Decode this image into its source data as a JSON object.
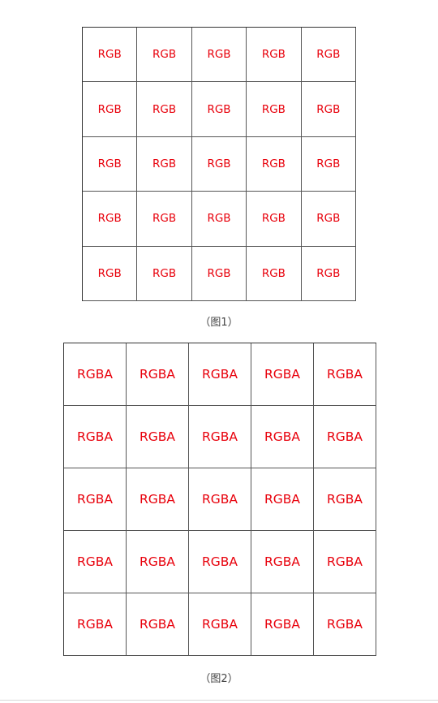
{
  "figure1": {
    "caption": "（图1）",
    "rows": [
      [
        "RGB",
        "RGB",
        "RGB",
        "RGB",
        "RGB"
      ],
      [
        "RGB",
        "RGB",
        "RGB",
        "RGB",
        "RGB"
      ],
      [
        "RGB",
        "RGB",
        "RGB",
        "RGB",
        "RGB"
      ],
      [
        "RGB",
        "RGB",
        "RGB",
        "RGB",
        "RGB"
      ],
      [
        "RGB",
        "RGB",
        "RGB",
        "RGB",
        "RGB"
      ]
    ]
  },
  "figure2": {
    "caption": "（图2）",
    "rows": [
      [
        "RGBA",
        "RGBA",
        "RGBA",
        "RGBA",
        "RGBA"
      ],
      [
        "RGBA",
        "RGBA",
        "RGBA",
        "RGBA",
        "RGBA"
      ],
      [
        "RGBA",
        "RGBA",
        "RGBA",
        "RGBA",
        "RGBA"
      ],
      [
        "RGBA",
        "RGBA",
        "RGBA",
        "RGBA",
        "RGBA"
      ],
      [
        "RGBA",
        "RGBA",
        "RGBA",
        "RGBA",
        "RGBA"
      ]
    ]
  },
  "colors": {
    "cell_text": "#e8000b",
    "grid_line": "#333333"
  }
}
